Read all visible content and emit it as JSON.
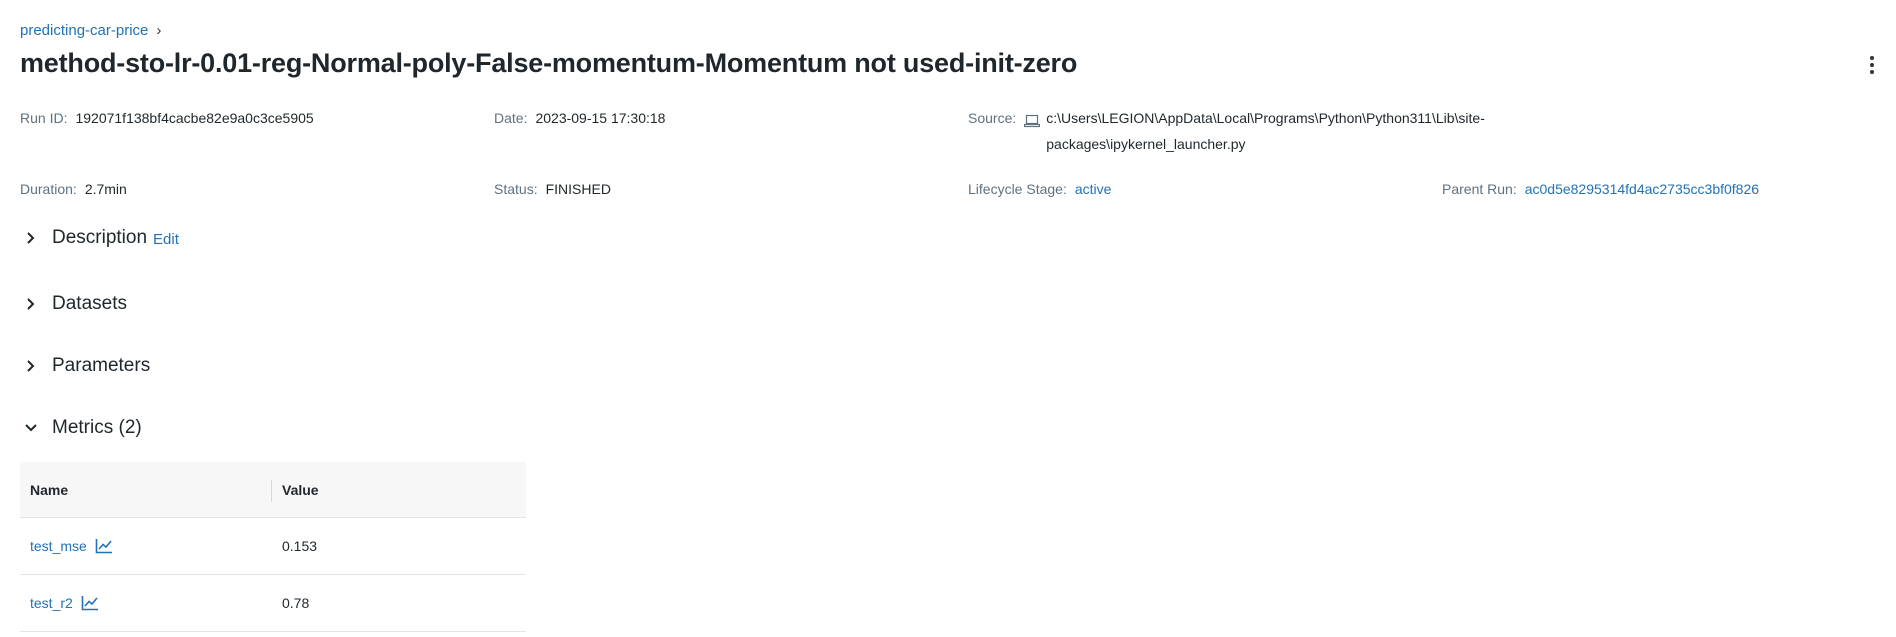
{
  "breadcrumb": {
    "experiment": "predicting-car-price",
    "separator": "›"
  },
  "run": {
    "title": "method-sto-lr-0.01-reg-Normal-poly-False-momentum-Momentum not used-init-zero",
    "run_id_label": "Run ID:",
    "run_id": "192071f138bf4cacbe82e9a0c3ce5905",
    "date_label": "Date:",
    "date": "2023-09-15 17:30:18",
    "source_label": "Source:",
    "source": "c:\\Users\\LEGION\\AppData\\Local\\Programs\\Python\\Python311\\Lib\\site-packages\\ipykernel_launcher.py",
    "source_icon": "laptop-icon",
    "duration_label": "Duration:",
    "duration": "2.7min",
    "status_label": "Status:",
    "status": "FINISHED",
    "lifecycle_label": "Lifecycle Stage:",
    "lifecycle": "active",
    "parent_label": "Parent Run:",
    "parent_run": "ac0d5e8295314fd4ac2735cc3bf0f826"
  },
  "sections": {
    "description": "Description",
    "description_edit": "Edit",
    "datasets": "Datasets",
    "parameters": "Parameters",
    "metrics": "Metrics (2)"
  },
  "metrics_table": {
    "headers": {
      "name": "Name",
      "value": "Value"
    },
    "rows": [
      {
        "name": "test_mse",
        "value": "0.153"
      },
      {
        "name": "test_r2",
        "value": "0.78"
      }
    ]
  },
  "colors": {
    "link": "#2272b4",
    "text": "#1f272d",
    "muted": "#5f7281",
    "header_bg": "#f7f7f7"
  }
}
